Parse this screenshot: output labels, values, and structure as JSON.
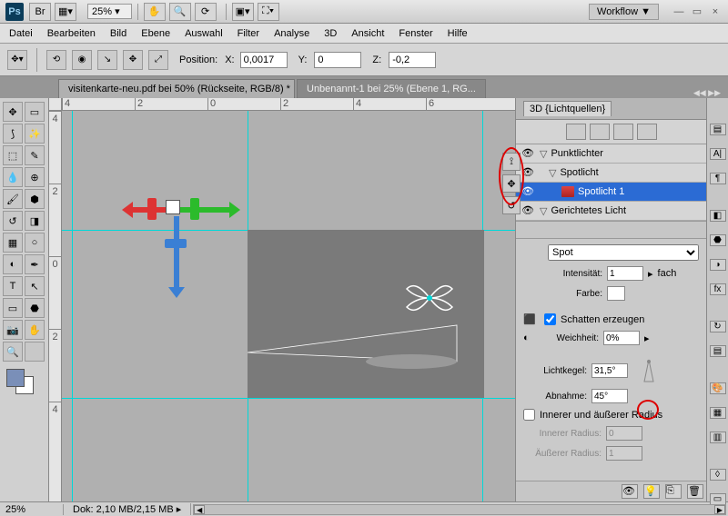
{
  "titlebar": {
    "ps": "Ps",
    "br": "Br",
    "zoom": "25% ▾",
    "workflow": "Workflow ▼",
    "min": "—",
    "max": "▭",
    "close": "×"
  },
  "menu": [
    "Datei",
    "Bearbeiten",
    "Bild",
    "Ebene",
    "Auswahl",
    "Filter",
    "Analyse",
    "3D",
    "Ansicht",
    "Fenster",
    "Hilfe"
  ],
  "options": {
    "position_label": "Position:",
    "x_label": "X:",
    "x": "0,0017",
    "y_label": "Y:",
    "y": "0",
    "z_label": "Z:",
    "z": "-0,2"
  },
  "tabs": {
    "t1": "visitenkarte-neu.pdf bei 50% (Rückseite, RGB/8) *",
    "t2": "Unbenannt-1 bei 25% (Ebene 1, RG...",
    "arrows": "◀◀ ▶▶"
  },
  "rulers": {
    "h": [
      "4",
      "2",
      "0",
      "2",
      "4",
      "6"
    ],
    "v": [
      "4",
      "2",
      "0",
      "2",
      "4"
    ]
  },
  "panel": {
    "title": "3D {Lichtquellen}",
    "groups": {
      "punkt": "Punktlichter",
      "spot": "Spotlicht",
      "spot1": "Spotlicht 1",
      "gericht": "Gerichtetes Licht"
    },
    "spot_sel": "Spot",
    "intensity_label": "Intensität:",
    "intensity_val": "1",
    "intensity_unit": "fach",
    "color_label": "Farbe:",
    "shadow_label": "Schatten erzeugen",
    "softness_label": "Weichheit:",
    "softness_val": "0%",
    "cone_label": "Lichtkegel:",
    "cone_val": "31,5°",
    "falloff_label": "Abnahme:",
    "falloff_val": "45°",
    "radius_check": "Innerer und äußerer Radius",
    "inner_label": "Innerer Radius:",
    "inner_val": "0",
    "outer_label": "Äußerer Radius:",
    "outer_val": "1"
  },
  "status": {
    "zoom": "25%",
    "dok": "Dok: 2,10 MB/2,15 MB"
  }
}
